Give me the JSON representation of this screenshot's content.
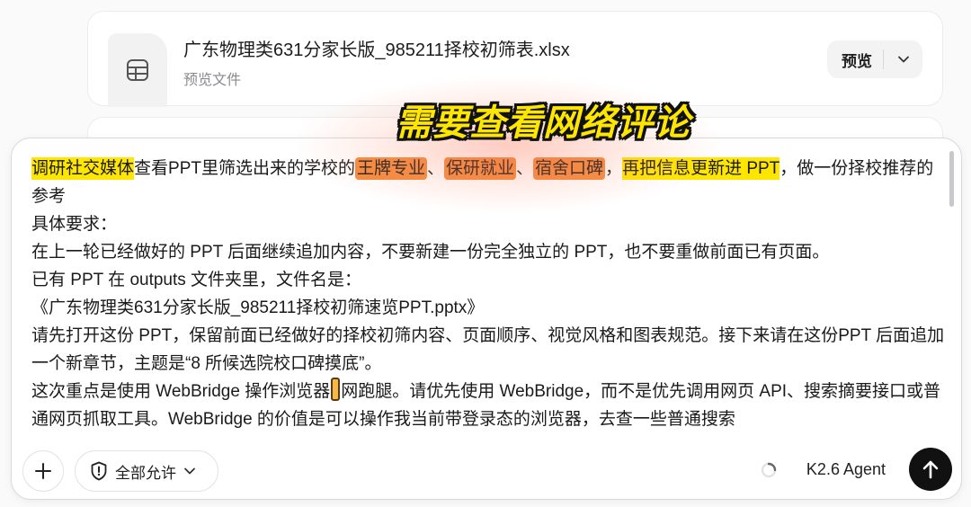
{
  "file_card": {
    "filename": "广东物理类631分家长版_985211择校初筛表.xlsx",
    "subtitle": "预览文件",
    "preview_label": "预览",
    "icon": "spreadsheet-icon"
  },
  "overlay": {
    "caption": "需要查看网络评论"
  },
  "composer": {
    "line1": {
      "hl1": "调研社交媒体",
      "t1": "查看PPT里筛选出来的学校的",
      "hl2": "王牌专业",
      "s1": "、",
      "hl3": "保研就业",
      "s2": "、",
      "hl4": "宿舍口碑",
      "s3": "，",
      "hl5": "再把信息更新进 PPT",
      "t2": "，做一份择校推荐的参考"
    },
    "lines": [
      "具体要求：",
      "在上一轮已经做好的 PPT 后面继续追加内容，不要新建一份完全独立的 PPT，也不要重做前面已有页面。",
      "已有 PPT 在 outputs 文件夹里，文件名是：",
      "《广东物理类631分家长版_985211择校初筛速览PPT.pptx》",
      "请先打开这份 PPT，保留前面已经做好的择校初筛内容、页面顺序、视觉风格和图表规范。接下来请在这份PPT 后面追加一个新章节，主题是“8 所候选院校口碑摸底”。"
    ],
    "last": {
      "before_cursor": "这次重点是使用 WebBridge 操作浏览器",
      "after_cursor": "网跑腿。请优先使用 WebBridge，而不是优先调用网页 API、搜索摘要接口或普通网页抓取工具。WebBridge 的价值是可以操作我当前带登录态的浏览器，去查一些普通搜索"
    },
    "permission_label": "全部允许",
    "agent_label": "K2.6 Agent"
  },
  "colors": {
    "highlight_yellow": "#ffe600",
    "highlight_orange": "#f28a3c",
    "send_button": "#111111"
  }
}
